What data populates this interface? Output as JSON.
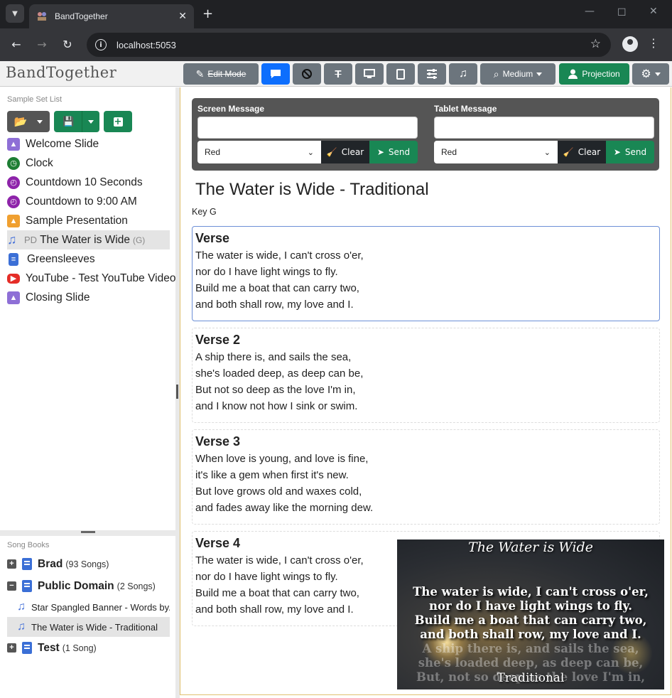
{
  "browser": {
    "tab_title": "BandTogether",
    "url": "localhost:5053"
  },
  "app": {
    "brand": "BandTogether",
    "toolbar": {
      "edit_mode": "Edit Mode",
      "size_label": "Medium",
      "projection": "Projection"
    }
  },
  "set_list": {
    "label": "Sample Set List",
    "items": [
      {
        "label": "Welcome Slide",
        "icon": "image-icon",
        "color": "#8e6fd6"
      },
      {
        "label": "Clock",
        "icon": "clock-icon",
        "color": "#1e7e34"
      },
      {
        "label": "Countdown 10 Seconds",
        "icon": "stopwatch-icon",
        "color": "#8e24aa"
      },
      {
        "label": "Countdown to 9:00 AM",
        "icon": "stopwatch-icon",
        "color": "#8e24aa"
      },
      {
        "label": "Sample Presentation",
        "icon": "presentation-icon",
        "color": "#f0a030"
      },
      {
        "label": "The Water is Wide",
        "prefix": "PD",
        "key": "(G)",
        "icon": "music-note-icon",
        "color": "#4a74d9"
      },
      {
        "label": "Greensleeves",
        "icon": "document-icon",
        "color": "#3b6fd6"
      },
      {
        "label": "YouTube - Test YouTube Video",
        "icon": "youtube-icon",
        "color": "#e52d27"
      },
      {
        "label": "Closing Slide",
        "icon": "image-icon",
        "color": "#8e6fd6"
      }
    ]
  },
  "song_books": {
    "label": "Song Books",
    "books": [
      {
        "name": "Brad",
        "count": "(93 Songs)",
        "expanded": false
      },
      {
        "name": "Public Domain",
        "count": "(2 Songs)",
        "expanded": true,
        "songs": [
          "Star Spangled Banner - Words by...",
          "The Water is Wide - Traditional"
        ]
      },
      {
        "name": "Test",
        "count": "(1 Song)",
        "expanded": false
      }
    ]
  },
  "messages": {
    "screen": {
      "label": "Screen Message",
      "color": "Red",
      "clear": "Clear",
      "send": "Send"
    },
    "tablet": {
      "label": "Tablet Message",
      "color": "Red",
      "clear": "Clear",
      "send": "Send"
    }
  },
  "song": {
    "title": "The Water is Wide - Traditional",
    "key": "Key G",
    "verses": [
      {
        "name": "Verse",
        "lines": [
          "The water is wide, I can't cross o'er,",
          "nor do I have light wings to fly.",
          "Build me a boat that can carry two,",
          "and both shall row, my love and I."
        ]
      },
      {
        "name": "Verse 2",
        "lines": [
          "A ship there is, and sails the sea,",
          "she's loaded deep, as deep can be,",
          "But not so deep as the love I'm in,",
          "and I know not how I sink or swim."
        ]
      },
      {
        "name": "Verse 3",
        "lines": [
          "When love is young, and love is fine,",
          "it's like a gem when first it's new.",
          "But love grows old and waxes cold,",
          "and fades away like the morning dew."
        ]
      },
      {
        "name": "Verse 4",
        "lines": [
          "The water is wide, I can't cross o'er,",
          "nor do I have light wings to fly.",
          "Build me a boat that can carry two,",
          "and both shall row, my love and I."
        ]
      }
    ]
  },
  "preview": {
    "title": "The Water is Wide",
    "lines": [
      "The water is wide, I can't cross o'er,",
      "nor do I have light wings to fly.",
      "Build me a boat that can carry two,",
      "and both shall row, my love and I."
    ],
    "next_lines": [
      "A ship there is, and sails the sea,",
      "she's loaded deep, as deep can be,",
      "But, not so deep as the love I'm in,"
    ],
    "author": "Traditional"
  }
}
